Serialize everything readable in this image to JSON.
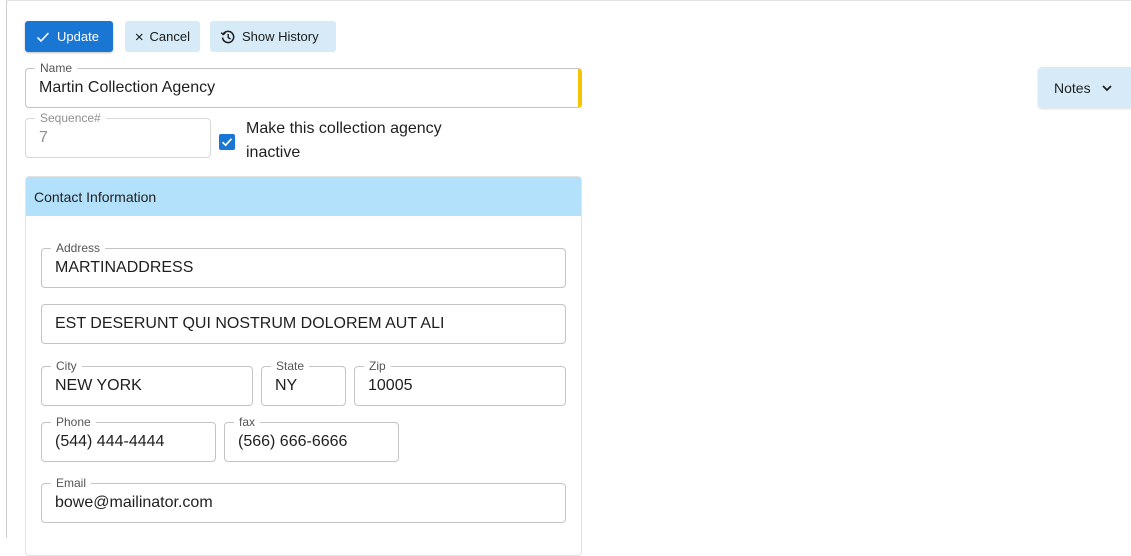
{
  "toolbar": {
    "update_label": "Update",
    "cancel_label": "Cancel",
    "history_label": "Show History"
  },
  "form": {
    "name": {
      "label": "Name",
      "value": "Martin Collection Agency"
    },
    "sequence": {
      "label": "Sequence#",
      "value": "7"
    },
    "inactive": {
      "label": "Make this collection agency inactive",
      "checked": true
    }
  },
  "contact": {
    "header": "Contact Information",
    "address": {
      "label": "Address",
      "value": "MARTINADDRESS"
    },
    "address2": {
      "value": "EST DESERUNT QUI NOSTRUM DOLOREM AUT ALI"
    },
    "city": {
      "label": "City",
      "value": "NEW YORK"
    },
    "state": {
      "label": "State",
      "value": "NY"
    },
    "zip": {
      "label": "Zip",
      "value": "10005"
    },
    "phone": {
      "label": "Phone",
      "value": "(544) 444-4444"
    },
    "fax": {
      "label": "fax",
      "value": "(566) 666-6666"
    },
    "email": {
      "label": "Email",
      "value": "bowe@mailinator.com"
    }
  },
  "notes_panel": {
    "label": "Notes"
  },
  "colors": {
    "primary": "#1976d2",
    "secondary_button": "#d6ebf7",
    "card_header": "#b3e1fb",
    "required_marker": "#f5c400"
  }
}
